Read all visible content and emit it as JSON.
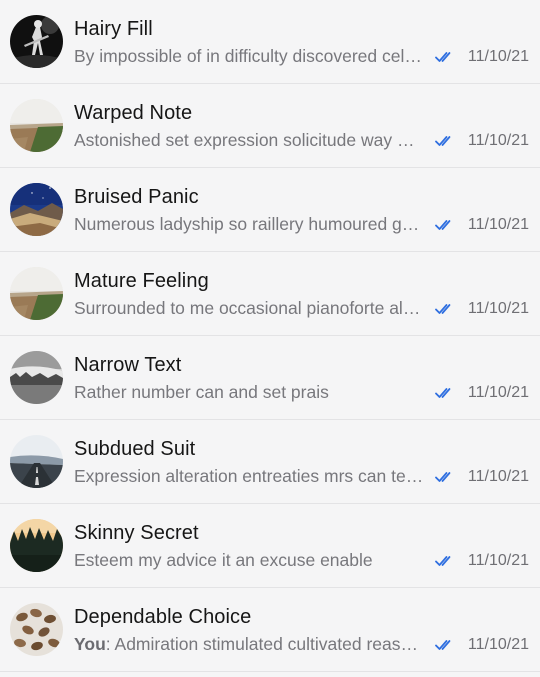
{
  "conversations": [
    {
      "name": "Hairy Fill",
      "sender": "",
      "preview": "By impossible of in difficulty discovered celebrated",
      "date": "11/10/21",
      "status_icon": "double-check-icon",
      "avatar_icon": "avatar-concert-photo"
    },
    {
      "name": "Warped Note",
      "sender": "",
      "preview": "Astonished set expression solicitude way admiration",
      "date": "11/10/21",
      "status_icon": "double-check-icon",
      "avatar_icon": "avatar-field-photo"
    },
    {
      "name": "Bruised Panic",
      "sender": "",
      "preview": "Numerous ladyship so raillery humoured goodness",
      "date": "11/10/21",
      "status_icon": "double-check-icon",
      "avatar_icon": "avatar-night-sky-photo"
    },
    {
      "name": "Mature Feeling",
      "sender": "",
      "preview": "Surrounded to me occasional pianoforte alteration",
      "date": "11/10/21",
      "status_icon": "double-check-icon",
      "avatar_icon": "avatar-field-photo"
    },
    {
      "name": "Narrow Text",
      "sender": "",
      "preview": "Rather number can and set prais",
      "date": "11/10/21",
      "status_icon": "double-check-icon",
      "avatar_icon": "avatar-foggy-photo"
    },
    {
      "name": "Subdued Suit",
      "sender": "",
      "preview": "Expression alteration entreaties mrs can terminated",
      "date": "11/10/21",
      "status_icon": "double-check-icon",
      "avatar_icon": "avatar-road-photo"
    },
    {
      "name": "Skinny Secret",
      "sender": "",
      "preview": "Esteem my advice it an excuse enable",
      "date": "11/10/21",
      "status_icon": "double-check-icon",
      "avatar_icon": "avatar-forest-photo"
    },
    {
      "name": "Dependable Choice",
      "sender": "You",
      "preview": "Admiration stimulated cultivated reasonable",
      "date": "11/10/21",
      "status_icon": "double-check-icon",
      "avatar_icon": "avatar-coffee-beans-photo"
    }
  ],
  "colors": {
    "background": "#f5f5f6",
    "divider": "#e3e3e5",
    "read_check": "#2f6fe0",
    "name_text": "#161616",
    "preview_text": "#77777c"
  }
}
